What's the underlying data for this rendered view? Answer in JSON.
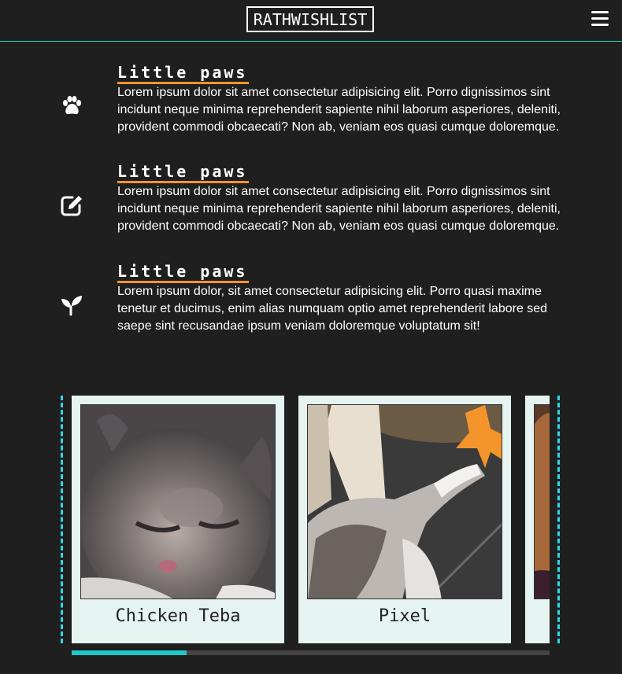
{
  "header": {
    "logo_text": "RATHWISHLIST",
    "menu_icon": "hamburger-menu-icon"
  },
  "features": [
    {
      "icon": "paw-icon",
      "title": "Little paws",
      "text": "Lorem ipsum dolor sit amet consectetur adipisicing elit. Porro dignissimos sint incidunt neque minima reprehenderit sapiente nihil laborum asperiores, deleniti, provident commodi obcaecati? Non ab, veniam eos quasi cumque doloremque."
    },
    {
      "icon": "edit-icon",
      "title": "Little paws",
      "text": "Lorem ipsum dolor sit amet consectetur adipisicing elit. Porro dignissimos sint incidunt neque minima reprehenderit sapiente nihil laborum asperiores, deleniti, provident commodi obcaecati? Non ab, veniam eos quasi cumque doloremque."
    },
    {
      "icon": "sprout-icon",
      "title": "Little paws",
      "text": "Lorem ipsum dolor, sit amet consectetur adipisicing elit. Porro quasi maxime tenetur et ducimus, enim alias numquam optio amet reprehenderit labore sed saepe sint recusandae ipsum veniam doloremque voluptatum sit!"
    }
  ],
  "cats": [
    {
      "name": "Chicken Teba",
      "photo": "kitten-photo",
      "favorite": false
    },
    {
      "name": "Pixel",
      "photo": "cat-photo",
      "favorite": true
    },
    {
      "name": "",
      "photo": "cat-photo-partial",
      "favorite": false
    }
  ],
  "carousel": {
    "progress": 0.24
  },
  "colors": {
    "background": "#1f1f1f",
    "accent_cyan": "#2fd8e8",
    "accent_orange": "#f3952b",
    "card_bg": "#e6f4f1"
  }
}
